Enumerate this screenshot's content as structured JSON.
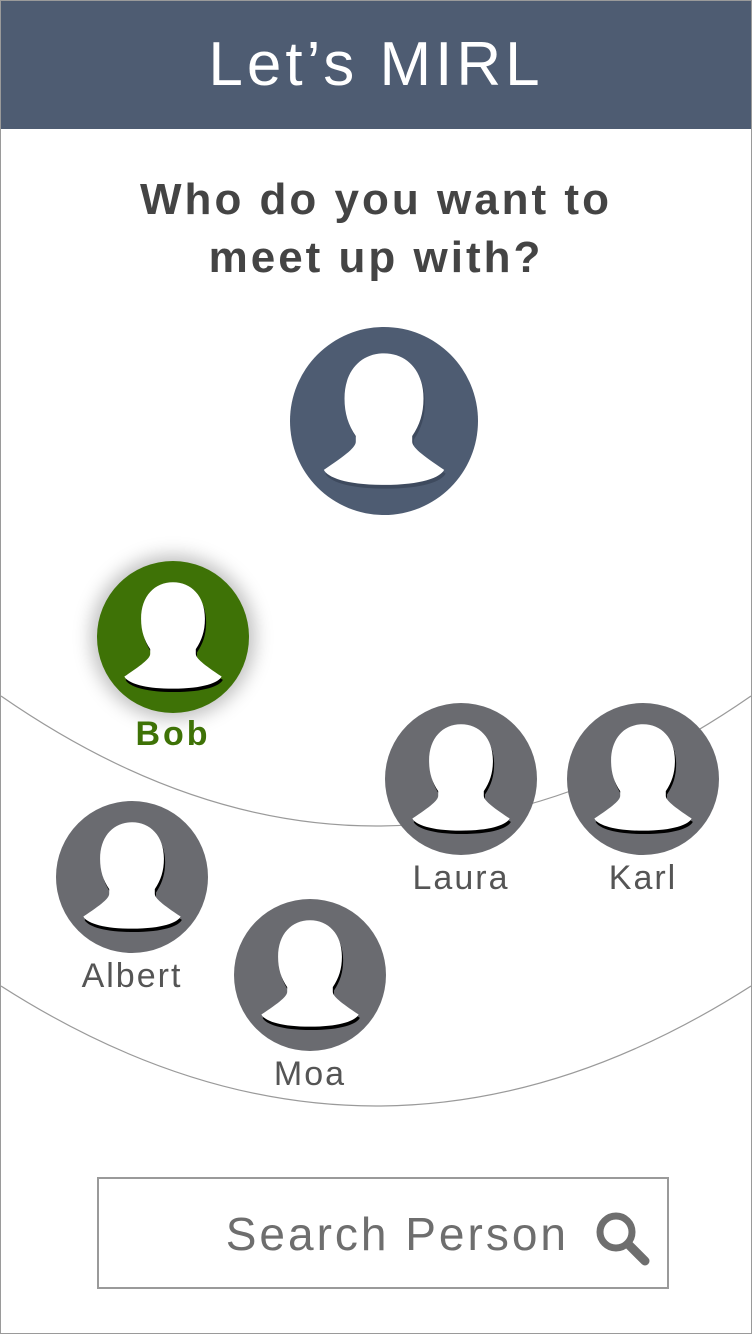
{
  "header": {
    "title": "Let’s MIRL"
  },
  "prompt": {
    "line1": "Who do you want to",
    "line2": "meet up with?"
  },
  "me": {
    "icon": "person-avatar-icon",
    "color": "#4e5c72"
  },
  "contacts": [
    {
      "name": "Bob",
      "selected": true,
      "color": "#3e7206"
    },
    {
      "name": "Laura",
      "selected": false,
      "color": "#6a6b70"
    },
    {
      "name": "Karl",
      "selected": false,
      "color": "#6a6b70"
    },
    {
      "name": "Albert",
      "selected": false,
      "color": "#6a6b70"
    },
    {
      "name": "Moa",
      "selected": false,
      "color": "#6a6b70"
    }
  ],
  "search": {
    "placeholder": "Search Person",
    "value": "",
    "icon": "search-icon"
  },
  "colors": {
    "header_bg": "#4e5c72",
    "selected": "#3e7206",
    "contact": "#6a6b70"
  }
}
